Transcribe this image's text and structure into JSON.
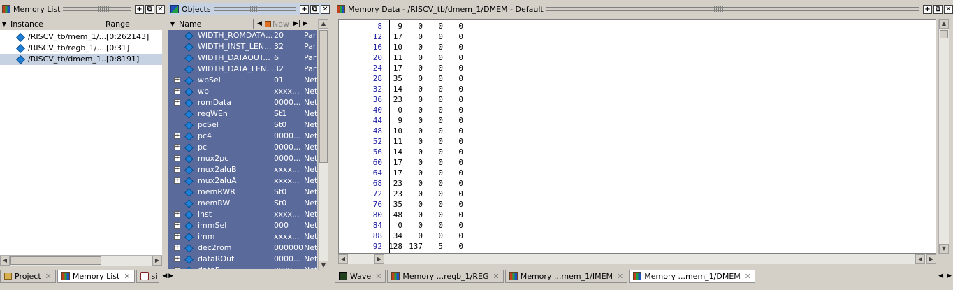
{
  "memory_list": {
    "title": "Memory List",
    "col_instance": "Instance",
    "col_range": "Range",
    "rows": [
      {
        "instance": "/RISCV_tb/mem_1/...",
        "range": "[0:262143]"
      },
      {
        "instance": "/RISCV_tb/regb_1/...",
        "range": "[0:31]"
      },
      {
        "instance": "/RISCV_tb/dmem_1...",
        "range": "[0:8191]"
      }
    ]
  },
  "objects": {
    "title": "Objects",
    "col_name": "Name",
    "now_label": "Now",
    "rows": [
      {
        "name": "WIDTH_ROMDATA...",
        "value": "20",
        "kind": "Par",
        "expandable": false
      },
      {
        "name": "WIDTH_INST_LEN...",
        "value": "32",
        "kind": "Par",
        "expandable": false
      },
      {
        "name": "WIDTH_DATAOUT...",
        "value": "6",
        "kind": "Par",
        "expandable": false
      },
      {
        "name": "WIDTH_DATA_LEN...",
        "value": "32",
        "kind": "Par",
        "expandable": false
      },
      {
        "name": "wbSel",
        "value": "01",
        "kind": "Net",
        "expandable": true
      },
      {
        "name": "wb",
        "value": "xxxx...",
        "kind": "Net",
        "expandable": true
      },
      {
        "name": "romData",
        "value": "0000...",
        "kind": "Net",
        "expandable": true
      },
      {
        "name": "regWEn",
        "value": "St1",
        "kind": "Net",
        "expandable": false
      },
      {
        "name": "pcSel",
        "value": "St0",
        "kind": "Net",
        "expandable": false
      },
      {
        "name": "pc4",
        "value": "0000...",
        "kind": "Net",
        "expandable": true
      },
      {
        "name": "pc",
        "value": "0000...",
        "kind": "Net",
        "expandable": true
      },
      {
        "name": "mux2pc",
        "value": "0000...",
        "kind": "Net",
        "expandable": true
      },
      {
        "name": "mux2aluB",
        "value": "xxxx...",
        "kind": "Net",
        "expandable": true
      },
      {
        "name": "mux2aluA",
        "value": "xxxx...",
        "kind": "Net",
        "expandable": true
      },
      {
        "name": "memRWR",
        "value": "St0",
        "kind": "Net",
        "expandable": false
      },
      {
        "name": "memRW",
        "value": "St0",
        "kind": "Net",
        "expandable": false
      },
      {
        "name": "inst",
        "value": "xxxx...",
        "kind": "Net",
        "expandable": true
      },
      {
        "name": "immSel",
        "value": "000",
        "kind": "Net",
        "expandable": true
      },
      {
        "name": "imm",
        "value": "xxxx...",
        "kind": "Net",
        "expandable": true
      },
      {
        "name": "dec2rom",
        "value": "000000",
        "kind": "Net",
        "expandable": true
      },
      {
        "name": "dataROut",
        "value": "0000...",
        "kind": "Net",
        "expandable": true
      },
      {
        "name": "dataR...",
        "value": "xxxx",
        "kind": "Net",
        "expandable": true
      }
    ]
  },
  "memory_data": {
    "title": "Memory Data - /RISCV_tb/dmem_1/DMEM - Default",
    "rows": [
      {
        "addr": "8",
        "v": [
          "9",
          "0",
          "0",
          "0"
        ]
      },
      {
        "addr": "12",
        "v": [
          "17",
          "0",
          "0",
          "0"
        ]
      },
      {
        "addr": "16",
        "v": [
          "10",
          "0",
          "0",
          "0"
        ]
      },
      {
        "addr": "20",
        "v": [
          "11",
          "0",
          "0",
          "0"
        ]
      },
      {
        "addr": "24",
        "v": [
          "17",
          "0",
          "0",
          "0"
        ]
      },
      {
        "addr": "28",
        "v": [
          "35",
          "0",
          "0",
          "0"
        ]
      },
      {
        "addr": "32",
        "v": [
          "14",
          "0",
          "0",
          "0"
        ]
      },
      {
        "addr": "36",
        "v": [
          "23",
          "0",
          "0",
          "0"
        ]
      },
      {
        "addr": "40",
        "v": [
          "0",
          "0",
          "0",
          "0"
        ]
      },
      {
        "addr": "44",
        "v": [
          "9",
          "0",
          "0",
          "0"
        ]
      },
      {
        "addr": "48",
        "v": [
          "10",
          "0",
          "0",
          "0"
        ]
      },
      {
        "addr": "52",
        "v": [
          "11",
          "0",
          "0",
          "0"
        ]
      },
      {
        "addr": "56",
        "v": [
          "14",
          "0",
          "0",
          "0"
        ]
      },
      {
        "addr": "60",
        "v": [
          "17",
          "0",
          "0",
          "0"
        ]
      },
      {
        "addr": "64",
        "v": [
          "17",
          "0",
          "0",
          "0"
        ]
      },
      {
        "addr": "68",
        "v": [
          "23",
          "0",
          "0",
          "0"
        ]
      },
      {
        "addr": "72",
        "v": [
          "23",
          "0",
          "0",
          "0"
        ]
      },
      {
        "addr": "76",
        "v": [
          "35",
          "0",
          "0",
          "0"
        ]
      },
      {
        "addr": "80",
        "v": [
          "48",
          "0",
          "0",
          "0"
        ]
      },
      {
        "addr": "84",
        "v": [
          "0",
          "0",
          "0",
          "0"
        ]
      },
      {
        "addr": "88",
        "v": [
          "34",
          "0",
          "0",
          "0"
        ]
      },
      {
        "addr": "92",
        "v": [
          "128",
          "137",
          "5",
          "0"
        ]
      }
    ]
  },
  "left_tabs": [
    {
      "label": "Project",
      "active": false
    },
    {
      "label": "Memory List",
      "active": true
    },
    {
      "label": "si",
      "active": false
    }
  ],
  "right_tabs": [
    {
      "label": "Wave",
      "active": false
    },
    {
      "label": "Memory ...regb_1/REG",
      "active": false
    },
    {
      "label": "Memory ...mem_1/IMEM",
      "active": false
    },
    {
      "label": "Memory ...mem_1/DMEM",
      "active": true
    }
  ],
  "colors": {
    "objects_bg": "#5a6a9a",
    "selection_bg": "#c6d2e2",
    "address_text": "#1a1aa0",
    "diamond_icon": "#1e7fd6"
  }
}
